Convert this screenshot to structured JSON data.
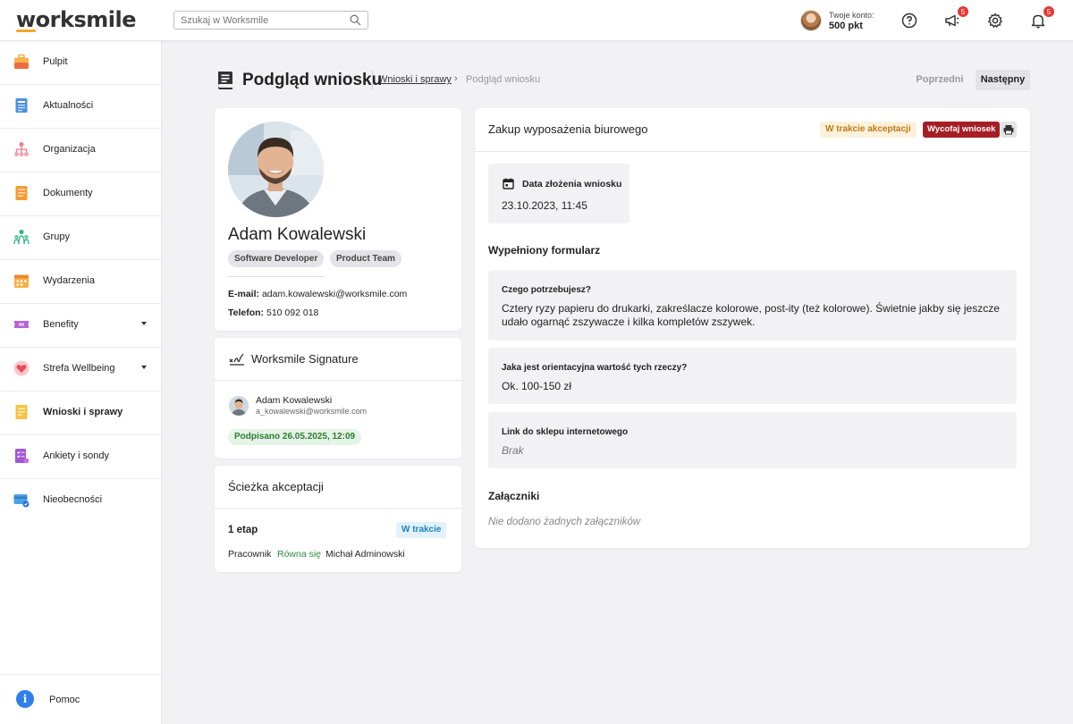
{
  "app": {
    "logo": "worksmile"
  },
  "search": {
    "placeholder": "Szukaj w Worksmile"
  },
  "account": {
    "label": "Twoje konto:",
    "points": "500 pkt"
  },
  "top_icons": {
    "help": "help-circle-icon",
    "announcements": {
      "icon": "megaphone-icon",
      "count": "5"
    },
    "settings": "gear-icon",
    "notifications": {
      "icon": "bell-icon",
      "count": "5"
    }
  },
  "sidebar": {
    "items": [
      {
        "label": "Pulpit",
        "icon": "briefcase-icon"
      },
      {
        "label": "Aktualności",
        "icon": "newspaper-icon"
      },
      {
        "label": "Organizacja",
        "icon": "org-chart-icon"
      },
      {
        "label": "Dokumenty",
        "icon": "document-icon"
      },
      {
        "label": "Grupy",
        "icon": "group-icon"
      },
      {
        "label": "Wydarzenia",
        "icon": "calendar-icon"
      },
      {
        "label": "Benefity",
        "icon": "ticket-icon",
        "expandable": true
      },
      {
        "label": "Strefa Wellbeing",
        "icon": "heart-icon",
        "expandable": true
      },
      {
        "label": "Wnioski i sprawy",
        "icon": "request-icon",
        "active": true
      },
      {
        "label": "Ankiety i sondy",
        "icon": "survey-icon"
      },
      {
        "label": "Nieobecności",
        "icon": "absence-icon"
      }
    ],
    "help": {
      "label": "Pomoc",
      "icon": "info-icon"
    }
  },
  "header": {
    "title": "Podgląd wniosku",
    "breadcrumb": {
      "link": "Wnioski i sprawy",
      "current": "Podgląd wniosku"
    },
    "prev_label": "Poprzedni",
    "next_label": "Następny"
  },
  "profile": {
    "name": "Adam Kowalewski",
    "tags": [
      "Software Developer",
      "Product Team"
    ],
    "email_label": "E-mail:",
    "email": "adam.kowalewski@worksmile.com",
    "phone_label": "Telefon:",
    "phone": "510 092 018"
  },
  "signature": {
    "title": "Worksmile Signature",
    "signer_name": "Adam Kowalewski",
    "signer_email": "a_kowalewski@worksmile.com",
    "status": "Podpisano 26.05.2025, 12:09"
  },
  "approval_path": {
    "title": "Ścieżka akceptacji",
    "stage": "1 etap",
    "stage_status": "W trakcie",
    "role": "Pracownik",
    "relation": "Równa się",
    "approver": "Michał Adminowski"
  },
  "request": {
    "title": "Zakup wyposażenia biurowego",
    "status": "W trakcie akceptacji",
    "withdraw_label": "Wycofaj wniosek",
    "submitted_label": "Data złożenia wniosku",
    "submitted_value": "23.10.2023, 11:45",
    "form_title": "Wypełniony formularz",
    "fields": [
      {
        "question": "Czego potrzebujesz?",
        "answer": "Cztery ryzy papieru do drukarki, zakreślacze kolorowe, post-ity (też kolorowe). Świetnie jakby się jeszcze udało ogarnąć zszywacze i kilka kompletów zszywek."
      },
      {
        "question": "Jaka jest orientacyjna wartość tych rzeczy?",
        "answer": "Ok. 100-150 zł"
      },
      {
        "question": "Link do sklepu internetowego",
        "answer": "Brak"
      }
    ],
    "attachments_title": "Załączniki",
    "attachments_empty": "Nie dodano żadnych załączników"
  },
  "colors": {
    "accent_orange": "#f5a623",
    "danger": "#a61d24",
    "success": "#2e7d32",
    "info": "#1d83c2",
    "warning": "#c07a12"
  }
}
